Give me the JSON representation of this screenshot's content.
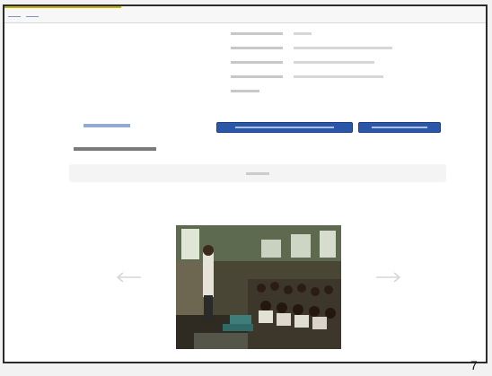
{
  "topbar": {
    "nav_links": [
      "",
      ""
    ]
  },
  "project_meta": {
    "rows": [
      {
        "label": "",
        "value": ""
      },
      {
        "label": "",
        "value": ""
      },
      {
        "label": "",
        "value": ""
      },
      {
        "label": "",
        "value": ""
      },
      {
        "label": "",
        "value": ""
      }
    ]
  },
  "actions": {
    "edit_link": "",
    "primary_button": "",
    "secondary_button": ""
  },
  "section": {
    "photos_videos_title": "",
    "video_area_label": ""
  },
  "carousel": {
    "prev_icon": "arrow-left-icon",
    "next_icon": "arrow-right-icon"
  },
  "page_number": "7",
  "colors": {
    "accent_blue": "#2a57a8",
    "frame_border": "#2b2b2b"
  }
}
